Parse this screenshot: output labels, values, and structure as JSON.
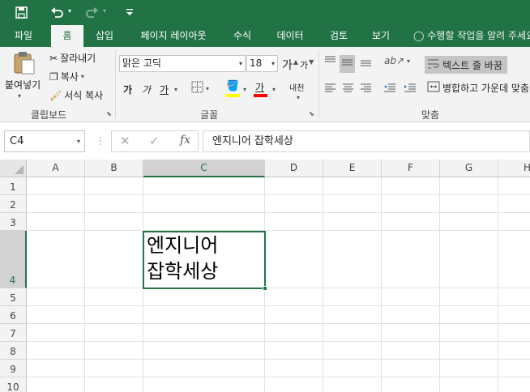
{
  "tabs": [
    "파일",
    "홈",
    "삽입",
    "페이지 레이아웃",
    "수식",
    "데이터",
    "검토",
    "보기"
  ],
  "tell_me": "수행할 작업을 알려 주세요",
  "clipboard": {
    "paste": "붙여넣기",
    "cut": "잘라내기",
    "copy": "복사",
    "format_painter": "서식 복사",
    "group_label": "클립보드"
  },
  "font": {
    "name": "맑은 고딕",
    "size": "18",
    "grow": "가",
    "shrink": "가",
    "bold": "가",
    "italic": "가",
    "underline": "가",
    "font_color_glyph": "가",
    "phonetic": "내천",
    "group_label": "글꼴"
  },
  "alignment": {
    "wrap_text": "텍스트 줄 바꿈",
    "merge_center": "병합하고 가운데 맞춤",
    "group_label": "맞춤"
  },
  "formula_bar": {
    "name_box": "C4",
    "formula": "엔지니어 잡학세상"
  },
  "columns": [
    "A",
    "B",
    "C",
    "D",
    "E",
    "F",
    "G",
    "H"
  ],
  "rows": [
    "1",
    "2",
    "3",
    "4",
    "5",
    "6",
    "7",
    "8",
    "9",
    "10"
  ],
  "active_cell": {
    "ref": "C4",
    "text": "엔지니어 잡학세상"
  },
  "colors": {
    "accent": "#217346",
    "fill_bar": "#ffff00",
    "font_bar": "#ff0000"
  }
}
